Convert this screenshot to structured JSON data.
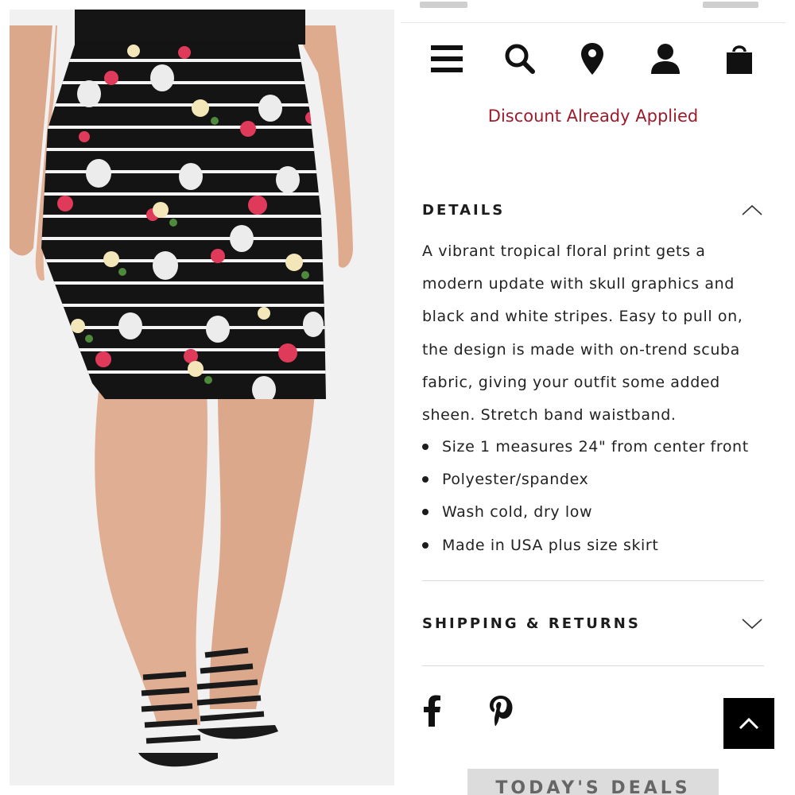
{
  "header": {
    "menu_icon": "hamburger-menu-icon",
    "search_icon": "search-icon",
    "location_icon": "map-pin-icon",
    "account_icon": "user-icon",
    "bag_icon": "shopping-bag-icon"
  },
  "discount_notice": "Discount Already Applied",
  "details": {
    "title": "DETAILS",
    "expanded": true,
    "description_lines": [
      "A vibrant tropical floral print gets a",
      "modern update with skull graphics and",
      "black and white stripes. Easy to pull on,",
      "the design is made with on-trend scuba",
      "fabric, giving your outfit some added",
      "sheen. Stretch band waistband."
    ],
    "bullets": [
      "Size 1 measures 24\" from center front",
      "Polyester/spandex",
      "Wash cold, dry low",
      "Made in USA plus size skirt"
    ]
  },
  "shipping": {
    "title": "SHIPPING & RETURNS",
    "expanded": false
  },
  "share": {
    "facebook_icon": "facebook-icon",
    "pinterest_icon": "pinterest-icon"
  },
  "back_to_top_icon": "chevron-up-icon",
  "deals_banner": "TODAY'S DEALS",
  "colors": {
    "discount": "#9b1c2c",
    "text": "#1c1c1c",
    "divider": "#dadada",
    "back_to_top_bg": "#000000",
    "deals_bar_bg": "#dcdcdc"
  },
  "product_photo": {
    "subject": "floral-skull-striped-pencil-skirt"
  }
}
